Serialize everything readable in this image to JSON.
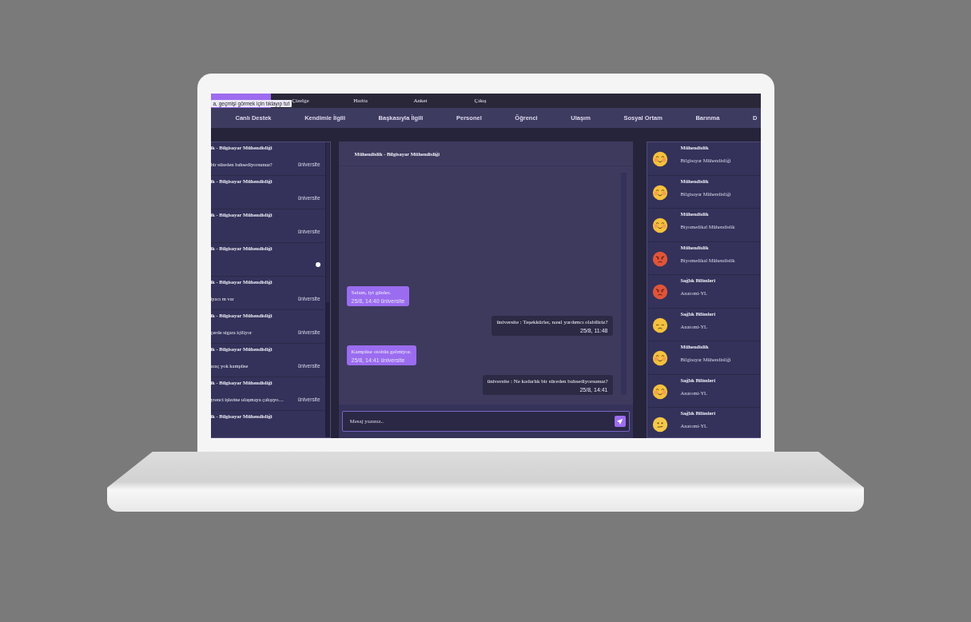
{
  "nav": {
    "items": [
      {
        "selected": true
      },
      {
        "label": "Çizelge",
        "selected": false
      },
      {
        "label": "Harita",
        "selected": false
      },
      {
        "label": "Anket",
        "selected": false
      },
      {
        "label": "Çıkış",
        "selected": false
      }
    ],
    "tooltip": "a, geçmişi görmek için tıklayıp tut"
  },
  "categories": [
    "Canlı Destek",
    "Kendimle İlgili",
    "Başkasıyla İlgili",
    "Personel",
    "Öğrenci",
    "Ulaşım",
    "Sosyal Ortam",
    "Barınma",
    "D"
  ],
  "conversations": [
    {
      "title": "ik - Bilgisayar Mühendisliği",
      "message": "bir süreden bahsediyorsunuz?",
      "sender": "üniversite",
      "unread": false
    },
    {
      "title": "ik - Bilgisayar Mühendisliği",
      "sender": "üniversite",
      "unread": false
    },
    {
      "title": "ik - Bilgisayar Mühendisliği",
      "sender": "üniversite",
      "unread": false
    },
    {
      "title": "ik - Bilgisayar Mühendisliği",
      "unread": true
    },
    {
      "title": "ik - Bilgisayar Mühendisliği",
      "message": "iyacı m var",
      "sender": "üniversite",
      "unread": false
    },
    {
      "title": "ik - Bilgisayar Mühendisliği",
      "message": "çerde sigara içiliyor",
      "sender": "üniversite",
      "unread": false
    },
    {
      "title": "ik - Bilgisayar Mühendisliği",
      "message": "araç yok kampüse",
      "sender": "üniversite",
      "unread": false
    },
    {
      "title": "ik - Bilgisayar Mühendisliği",
      "message": "yrenci işlerine ulaşmaya çalışıyo…",
      "sender": "üniversite",
      "unread": false
    },
    {
      "title": "ik - Bilgisayar Mühendisliği",
      "unread": false
    }
  ],
  "chat": {
    "title": "Mühendislik - Bilgisayar Mühendisliği",
    "messages": [
      {
        "kind": "incoming",
        "text": "Selam, iyi günler.",
        "meta": "25/8, 14:40 üniversite"
      },
      {
        "kind": "outgoing",
        "text": "üniversite : Teşekkürler, nasıl yardımcı olabiliriz?",
        "meta": "25/8, 11:48"
      },
      {
        "kind": "incoming",
        "text": "Kampüse otobüs gelmiyor.",
        "meta": "25/8, 14:41 üniversite"
      },
      {
        "kind": "outgoing",
        "text": "üniversite : Ne kadarlık bir süreden bahsediyorsunuz?",
        "meta": "25/8, 14:41"
      }
    ],
    "input": {
      "placeholder": "Mesaj yazınız.."
    }
  },
  "feedback": [
    {
      "kind": "happy",
      "faculty": "Mühendislik",
      "department": "Bilgisayar Mühendisliği"
    },
    {
      "kind": "happy",
      "faculty": "Mühendislik",
      "department": "Bilgisayar Mühendisliği"
    },
    {
      "kind": "happy",
      "faculty": "Mühendislik",
      "department": "Biyomedikal Mühendislik"
    },
    {
      "kind": "angry",
      "faculty": "Mühendislik",
      "department": "Biyomedikal Mühendislik"
    },
    {
      "kind": "angry",
      "faculty": "Sağlık Bilimleri",
      "department": "Anatomi-YL"
    },
    {
      "kind": "sad",
      "faculty": "Sağlık Bilimleri",
      "department": "Anatomi-YL"
    },
    {
      "kind": "happy",
      "faculty": "Mühendislik",
      "department": "Bilgisayar Mühendisliği"
    },
    {
      "kind": "happy",
      "faculty": "Sağlık Bilimleri",
      "department": "Anatomi-YL"
    },
    {
      "kind": "confused",
      "faculty": "Sağlık Bilimleri",
      "department": "Anatomi-YL"
    }
  ]
}
